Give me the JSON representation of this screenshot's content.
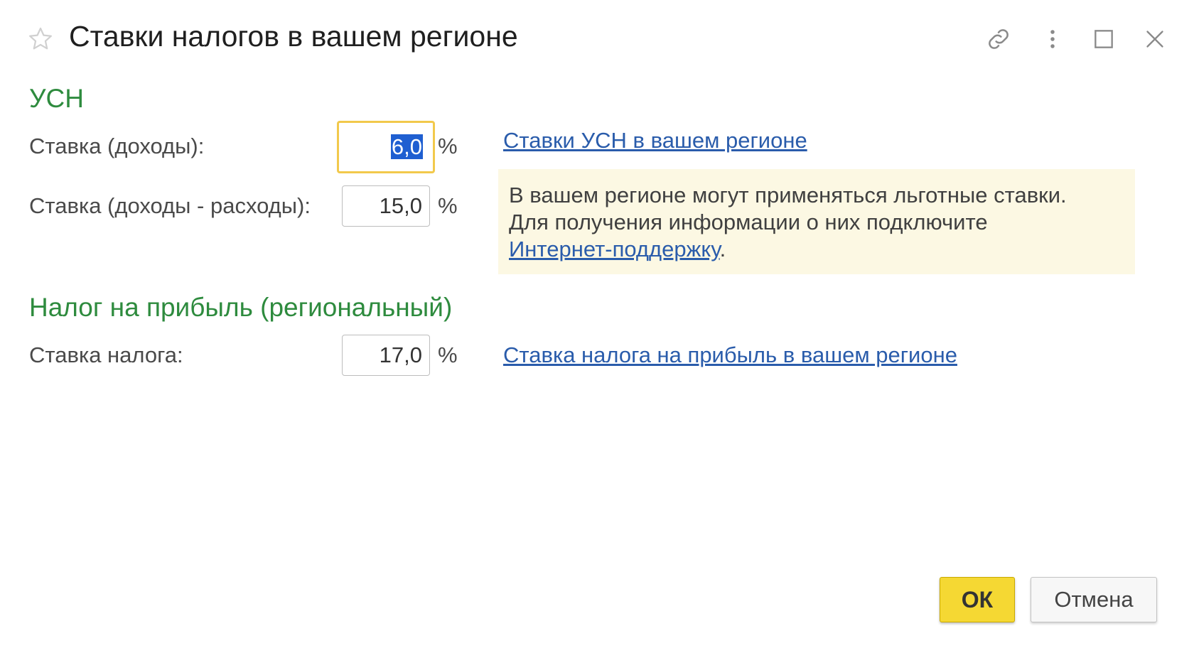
{
  "window": {
    "title": "Ставки налогов в вашем регионе"
  },
  "icons": {
    "favorite": "star-icon",
    "link": "link-icon",
    "more": "more-vertical-icon",
    "maximize": "maximize-icon",
    "close": "close-icon"
  },
  "usn": {
    "heading": "УСН",
    "income_label": "Ставка (доходы):",
    "income_value": "6,0",
    "income_minus_expense_label": "Ставка (доходы - расходы):",
    "income_minus_expense_value": "15,0",
    "percent": "%",
    "rates_link": "Ставки УСН в вашем регионе"
  },
  "info": {
    "line1": "В вашем регионе могут применяться льготные ставки.",
    "line2": "Для получения информации о них подключите",
    "link": "Интернет-поддержку",
    "suffix": "."
  },
  "profit_tax": {
    "heading": "Налог на прибыль (региональный)",
    "rate_label": "Ставка налога:",
    "rate_value": "17,0",
    "percent": "%",
    "rate_link": "Ставка налога на прибыль в вашем регионе"
  },
  "footer": {
    "ok_label": "ОК",
    "cancel_label": "Отмена"
  },
  "colors": {
    "heading_green": "#2e8b3e",
    "link_blue": "#2a5cab",
    "ok_yellow": "#f5d833",
    "focus_border": "#f2c94c",
    "info_bg": "#fcf8e3"
  }
}
